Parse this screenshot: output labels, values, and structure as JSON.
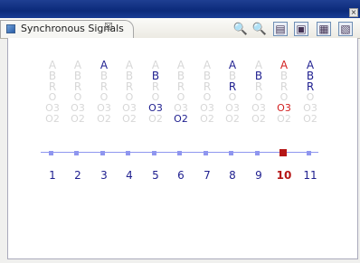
{
  "tab": {
    "title": "Synchronous Signals",
    "close_label": "☒"
  },
  "toolbar": [
    {
      "name": "zoom-in-icon",
      "label": "🔍"
    },
    {
      "name": "zoom-out-icon",
      "label": "🔍"
    },
    {
      "name": "export-icon",
      "label": "▤"
    },
    {
      "name": "save-icon",
      "label": "▣"
    },
    {
      "name": "fit-icon",
      "label": "▦"
    },
    {
      "name": "layout-icon",
      "label": "▧"
    }
  ],
  "signals": [
    {
      "step": "1",
      "A": "A",
      "B": "B",
      "R": "R",
      "O": "O",
      "O3": "O3",
      "O2": "O2",
      "state": "grey"
    },
    {
      "step": "2",
      "A": "A",
      "B": "B",
      "R": "R",
      "O": "O",
      "O3": "O3",
      "O2": "O2",
      "state": "grey"
    },
    {
      "step": "3",
      "A": "A",
      "B": "B",
      "R": "R",
      "O": "O",
      "O3": "O3",
      "O2": "O2",
      "state": "blueA"
    },
    {
      "step": "4",
      "A": "A",
      "B": "B",
      "R": "R",
      "O": "O",
      "O3": "O3",
      "O2": "O2",
      "state": "grey"
    },
    {
      "step": "5",
      "A": "A",
      "B": "B",
      "R": "R",
      "O": "O",
      "O3": "O3",
      "O2": "O2",
      "state": "blueB_O3"
    },
    {
      "step": "6",
      "A": "A",
      "B": "B",
      "R": "R",
      "O": "O",
      "O3": "O3",
      "O2": "O2",
      "state": "blueO2"
    },
    {
      "step": "7",
      "A": "A",
      "B": "B",
      "R": "R",
      "O": "O",
      "O3": "O3",
      "O2": "O2",
      "state": "grey"
    },
    {
      "step": "8",
      "A": "A",
      "B": "B",
      "R": "R",
      "O": "O",
      "O3": "O3",
      "O2": "O2",
      "state": "blueA_R"
    },
    {
      "step": "9",
      "A": "A",
      "B": "B",
      "R": "R",
      "O": "O",
      "O3": "O3",
      "O2": "O2",
      "state": "blueB"
    },
    {
      "step": "10",
      "A": "A",
      "B": "B",
      "R": "R",
      "O": "O",
      "O3": "O3",
      "O2": "O2",
      "state": "active"
    },
    {
      "step": "11",
      "A": "A",
      "B": "B",
      "R": "R",
      "O": "O",
      "O3": "O3",
      "O2": "O2",
      "state": "blueABR"
    }
  ]
}
